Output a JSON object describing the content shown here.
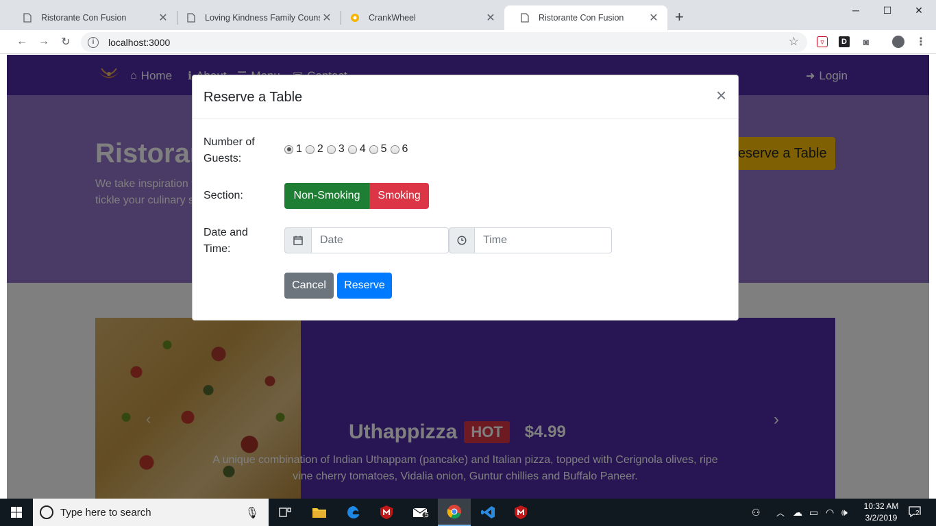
{
  "browser": {
    "tabs": [
      {
        "title": "Ristorante Con Fusion",
        "active": false
      },
      {
        "title": "Loving Kindness Family Counselin",
        "active": false
      },
      {
        "title": "CrankWheel",
        "active": false
      },
      {
        "title": "Ristorante Con Fusion",
        "active": true
      }
    ],
    "url": "localhost:3000",
    "extensions": [
      "pocket-icon",
      "d-extension-icon",
      "camera-icon",
      "profile-icon",
      "menu-icon"
    ]
  },
  "site": {
    "nav": {
      "home": "Home",
      "about": "About",
      "menu": "Menu",
      "contact": "Contact",
      "login": "Login"
    },
    "jumbotron": {
      "title": "Ristorante con Fusion",
      "text": "We take inspiration from the World's best cuisines, and create a unique fusion experience. Our lipsmacking creations will tickle your culinary senses!",
      "reserve_button": "Reserve a Table"
    },
    "featured": {
      "name": "Uthappizza",
      "badge": "HOT",
      "price": "$4.99",
      "description": "A unique combination of Indian Uthappam (pancake) and Italian pizza, topped with Cerignola olives, ripe vine cherry tomatoes, Vidalia onion, Guntur chillies and Buffalo Paneer."
    }
  },
  "modal": {
    "title": "Reserve a Table",
    "close": "×",
    "guests_label": "Number of Guests:",
    "guest_options": [
      "1",
      "2",
      "3",
      "4",
      "5",
      "6"
    ],
    "guests_selected": "1",
    "section_label": "Section:",
    "section_options": [
      "Non-Smoking",
      "Smoking"
    ],
    "datetime_label": "Date and Time:",
    "date_placeholder": "Date",
    "time_placeholder": "Time",
    "cancel": "Cancel",
    "reserve": "Reserve"
  },
  "taskbar": {
    "search_placeholder": "Type here to search",
    "mail_badge": "5",
    "time": "10:32 AM",
    "date": "3/2/2019",
    "notifications": "2"
  },
  "colors": {
    "nav": "#512da8",
    "jumbotron": "#9575cd",
    "non_smoking": "#1e7e34",
    "smoking": "#dc3545",
    "reserve": "#007bff",
    "cancel": "#6c757d",
    "warning": "#ffc107"
  }
}
